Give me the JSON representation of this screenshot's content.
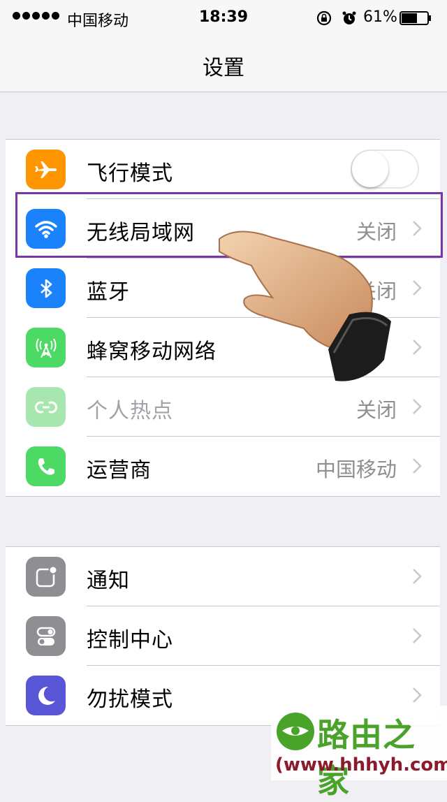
{
  "status_bar": {
    "carrier": "中国移动",
    "time": "18:39",
    "battery": "61%",
    "battery_level": 0.61
  },
  "nav": {
    "title": "设置"
  },
  "group1": [
    {
      "icon": "airplane-icon",
      "color": "#ff9500",
      "label": "飞行模式",
      "control": "toggle",
      "toggle_on": false
    },
    {
      "icon": "wifi-icon",
      "color": "#1a82fb",
      "label": "无线局域网",
      "value": "关闭"
    },
    {
      "icon": "bluetooth-icon",
      "color": "#1a82fb",
      "label": "蓝牙",
      "value": "关闭"
    },
    {
      "icon": "cellular-icon",
      "color": "#4cd964",
      "label": "蜂窝移动网络",
      "value": ""
    },
    {
      "icon": "hotspot-icon",
      "color": "#a8e6b0",
      "label": "个人热点",
      "value": "关闭",
      "disabled": true
    },
    {
      "icon": "phone-icon",
      "color": "#4cd964",
      "label": "运营商",
      "value": "中国移动"
    }
  ],
  "group2": [
    {
      "icon": "notifications-icon",
      "color": "#8e8e93",
      "label": "通知"
    },
    {
      "icon": "control-center-icon",
      "color": "#8e8e93",
      "label": "控制中心"
    },
    {
      "icon": "moon-icon",
      "color": "#5856d6",
      "label": "勿扰模式"
    }
  ],
  "watermark": {
    "brand": "路由之家",
    "url": "(www.hhhyh.com)"
  }
}
